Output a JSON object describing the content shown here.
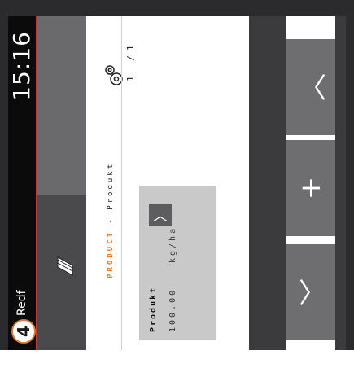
{
  "status": {
    "time": "15:16",
    "badge": "4",
    "account": "Redf"
  },
  "breadcrumb": {
    "section": "PRODUCT",
    "separator": " - ",
    "page": "Produkt"
  },
  "pager": "1 /1",
  "product_card": {
    "title": "Produkt",
    "value": "100.00",
    "unit": "kg/ha"
  },
  "buttons": {
    "add": "+",
    "down": "﹀",
    "up": "︿",
    "edit": "〉"
  },
  "icons": {
    "seed": "seed-icon",
    "settings": "gear-icon"
  },
  "colors": {
    "accent": "#e0782e",
    "statusbar": "#0b0b0b",
    "button": "#6e6e70"
  }
}
